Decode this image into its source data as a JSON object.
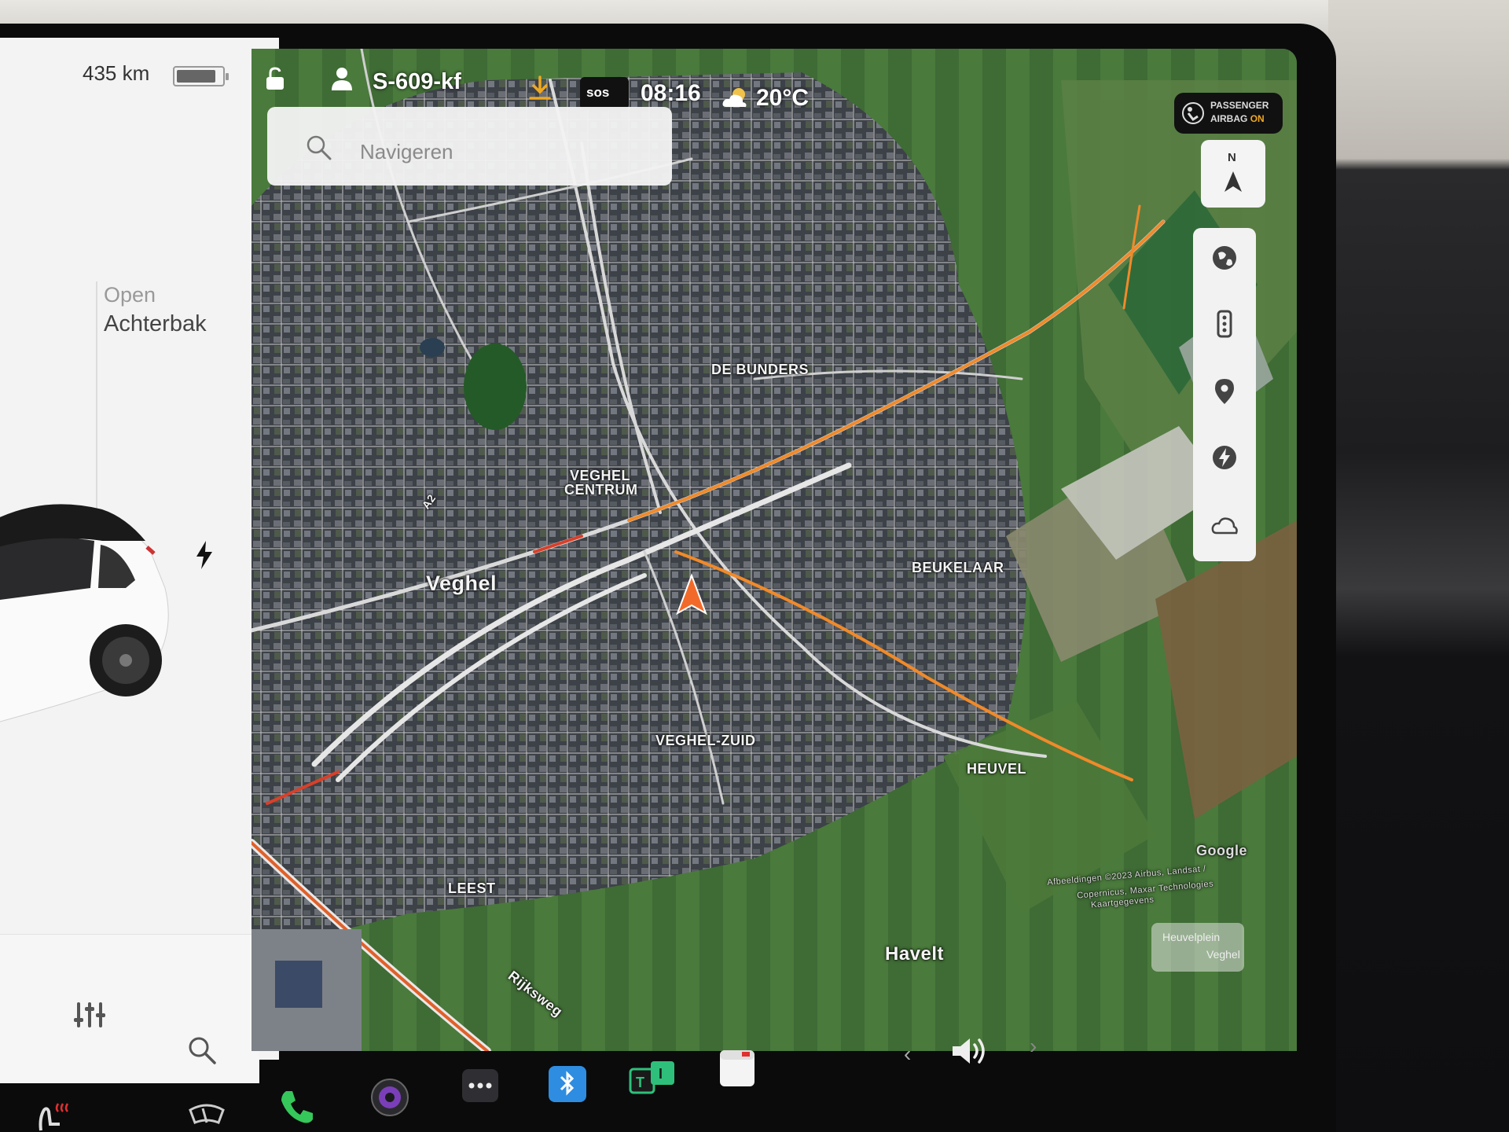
{
  "status_bar": {
    "plate": "S-609-kf",
    "sos": "sos",
    "time": "08:16",
    "temperature": "20°C",
    "airbag_line1": "PASSENGER",
    "airbag_line2_prefix": "AIRBAG",
    "airbag_state": "ON",
    "airbag_state_color": "#f0a820"
  },
  "car_panel": {
    "range": "435 km",
    "battery_level_percent": 85,
    "trunk_action": "Open",
    "trunk_label": "Achterbak"
  },
  "search": {
    "placeholder": "Navigeren"
  },
  "map": {
    "labels": {
      "de_bunders": "DE BUNDERS",
      "veghel_centrum_1": "VEGHEL",
      "veghel_centrum_2": "CENTRUM",
      "veghel": "Veghel",
      "beukelaar": "BEUKELAAR",
      "veghel_zuid": "VEGHEL-ZUID",
      "heuvel": "HEUVEL",
      "leest": "LEEST",
      "havelt": "Havelt",
      "rijksweg": "Rijksweg",
      "road_a2": "A2",
      "google": "Google",
      "attribution_1": "Afbeeldingen ©2023 Airbus, Landsat /",
      "attribution_2": "Copernicus, Maxar Technologies",
      "attribution_3": "Kaartgegevens",
      "location_card_1": "Heuvelplein",
      "location_card_2": "Veghel"
    },
    "route_color": "#f08a2a",
    "alt_route_color": "#d8402a"
  },
  "compass": {
    "letters": "N"
  },
  "controls": [
    "globe-icon",
    "traffic-icon",
    "pin-icon",
    "charging-icon",
    "weather-icon"
  ],
  "dock": [
    "seat-heat-icon",
    "wiper-icon",
    "phone-icon",
    "camera-icon",
    "more-icon",
    "bluetooth-icon",
    "toybox-icon",
    "calendar-icon"
  ]
}
